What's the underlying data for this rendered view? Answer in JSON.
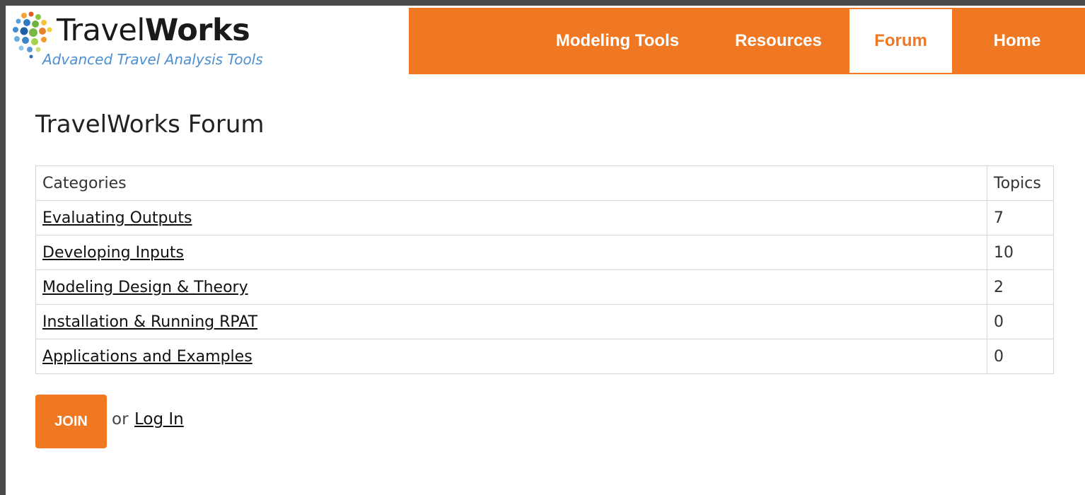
{
  "logo": {
    "word_light": "Travel",
    "word_bold": "Works",
    "tagline": "Advanced Travel Analysis Tools"
  },
  "nav": {
    "items": [
      {
        "label": "Modeling Tools",
        "active": false
      },
      {
        "label": "Resources",
        "active": false
      },
      {
        "label": "Forum",
        "active": true
      },
      {
        "label": "Home",
        "active": false
      }
    ]
  },
  "page": {
    "title": "TravelWorks Forum"
  },
  "table": {
    "headers": [
      "Categories",
      "Topics"
    ],
    "rows": [
      {
        "category": "Evaluating Outputs",
        "topics": "7"
      },
      {
        "category": "Developing Inputs",
        "topics": "10"
      },
      {
        "category": "Modeling Design & Theory",
        "topics": "2"
      },
      {
        "category": "Installation & Running RPAT",
        "topics": "0"
      },
      {
        "category": "Applications and Examples",
        "topics": "0"
      }
    ]
  },
  "auth": {
    "join_label": "JOIN",
    "or_text": "or",
    "login_label": "Log In"
  },
  "colors": {
    "brand_orange": "#f07822",
    "tagline_blue": "#4d8fd0"
  }
}
